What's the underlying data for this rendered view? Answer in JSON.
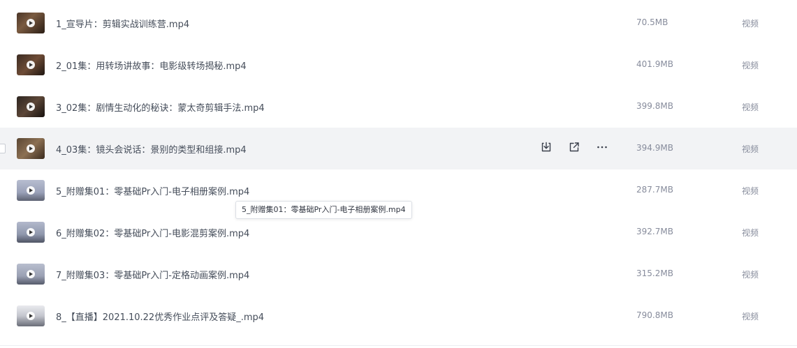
{
  "files": [
    {
      "name": "1_宣导片：剪辑实战训练营.mp4",
      "size": "70.5MB",
      "type": "视频",
      "thumb_icon": "video-thumbnail"
    },
    {
      "name": "2_01集：用转场讲故事：电影级转场揭秘.mp4",
      "size": "401.9MB",
      "type": "视频",
      "thumb_icon": "video-thumbnail"
    },
    {
      "name": "3_02集：剧情生动化的秘诀：蒙太奇剪辑手法.mp4",
      "size": "399.8MB",
      "type": "视频",
      "thumb_icon": "video-thumbnail"
    },
    {
      "name": "4_03集：镜头会说话：景别的类型和组接.mp4",
      "size": "394.9MB",
      "type": "视频",
      "thumb_icon": "video-thumbnail"
    },
    {
      "name": "5_附赠集01：零基础Pr入门-电子相册案例.mp4",
      "size": "287.7MB",
      "type": "视频",
      "thumb_icon": "video-thumbnail"
    },
    {
      "name": "6_附赠集02：零基础Pr入门-电影混剪案例.mp4",
      "size": "392.7MB",
      "type": "视频",
      "thumb_icon": "video-thumbnail"
    },
    {
      "name": "7_附赠集03：零基础Pr入门-定格动画案例.mp4",
      "size": "315.2MB",
      "type": "视频",
      "thumb_icon": "video-thumbnail"
    },
    {
      "name": "8_【直播】2021.10.22优秀作业点评及答疑_.mp4",
      "size": "790.8MB",
      "type": "视频",
      "thumb_icon": "video-thumbnail"
    }
  ],
  "hover_row_actions": [
    "download-icon",
    "share-icon",
    "more-icon"
  ],
  "tooltip": {
    "text": "5_附赠集01：零基础Pr入门-电子相册案例.mp4"
  },
  "colors": {
    "hover_row_bg": "#f2f3f5",
    "text": "#454d5a",
    "muted": "#878c9c"
  }
}
